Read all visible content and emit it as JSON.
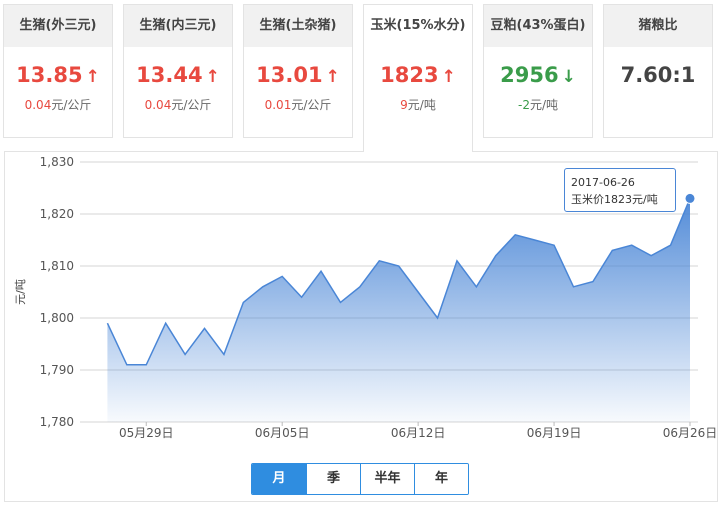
{
  "cards": [
    {
      "title": "生猪(外三元)",
      "price": "13.85",
      "arrow": "↑",
      "change_value": "0.04",
      "change_unit": "元/公斤",
      "trend": "up"
    },
    {
      "title": "生猪(内三元)",
      "price": "13.44",
      "arrow": "↑",
      "change_value": "0.04",
      "change_unit": "元/公斤",
      "trend": "up"
    },
    {
      "title": "生猪(土杂猪)",
      "price": "13.01",
      "arrow": "↑",
      "change_value": "0.01",
      "change_unit": "元/公斤",
      "trend": "up"
    },
    {
      "title": "玉米(15%水分)",
      "price": "1823",
      "arrow": "↑",
      "change_value": "9",
      "change_unit": "元/吨",
      "trend": "up"
    },
    {
      "title": "豆粕(43%蛋白)",
      "price": "2956",
      "arrow": "↓",
      "change_value": "-2",
      "change_unit": "元/吨",
      "trend": "down"
    },
    {
      "title": "猪粮比",
      "price": "7.60:1",
      "arrow": "",
      "change_value": "",
      "change_unit": "",
      "trend": "neutral"
    }
  ],
  "colors": {
    "up": "#e8493f",
    "down": "#3a9c4a",
    "accent": "#2f8de0",
    "line": "#4a86d6"
  },
  "tooltip": {
    "date": "2017-06-26",
    "label": "玉米价1823元/吨"
  },
  "range_buttons": [
    "月",
    "季",
    "半年",
    "年"
  ],
  "selected_range": "月",
  "chart_data": {
    "type": "area",
    "ylabel": "元/吨",
    "ylim": [
      1780,
      1830
    ],
    "yticks": [
      1780,
      1790,
      1800,
      1810,
      1820,
      1830
    ],
    "ytick_labels": [
      "1,780",
      "1,790",
      "1,800",
      "1,810",
      "1,820",
      "1,830"
    ],
    "xtick_labels": [
      {
        "label": "05月29日",
        "date": "2017-05-29"
      },
      {
        "label": "06月05日",
        "date": "2017-06-05"
      },
      {
        "label": "06月12日",
        "date": "2017-06-12"
      },
      {
        "label": "06月19日",
        "date": "2017-06-19"
      },
      {
        "label": "06月26日",
        "date": "2017-06-26"
      }
    ],
    "grid": true,
    "x": [
      "2017-05-26",
      "2017-05-27",
      "2017-05-28",
      "2017-05-29",
      "2017-05-30",
      "2017-05-31",
      "2017-06-01",
      "2017-06-02",
      "2017-06-03",
      "2017-06-04",
      "2017-06-05",
      "2017-06-06",
      "2017-06-07",
      "2017-06-08",
      "2017-06-09",
      "2017-06-10",
      "2017-06-11",
      "2017-06-12",
      "2017-06-13",
      "2017-06-14",
      "2017-06-15",
      "2017-06-16",
      "2017-06-17",
      "2017-06-18",
      "2017-06-19",
      "2017-06-20",
      "2017-06-21",
      "2017-06-22",
      "2017-06-23",
      "2017-06-24",
      "2017-06-25",
      "2017-06-26"
    ],
    "series": [
      {
        "values": [
          1799,
          1791,
          1791,
          1799,
          1793,
          1798,
          1793,
          1803,
          1806,
          1808,
          1804,
          1809,
          1803,
          1806,
          1811,
          1810,
          1805,
          1800,
          1811,
          1806,
          1812,
          1816,
          1815,
          1814,
          1806,
          1807,
          1813,
          1814,
          1812,
          1814,
          1823
        ]
      }
    ]
  }
}
